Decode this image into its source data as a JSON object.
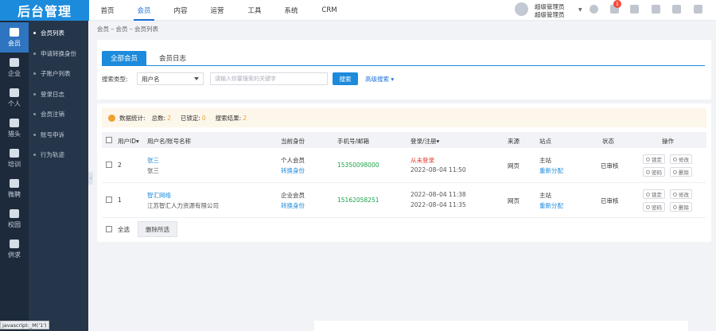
{
  "logo": {
    "text": "后台管理"
  },
  "rail": [
    {
      "label": "会员",
      "active": true
    },
    {
      "label": "企业"
    },
    {
      "label": "个人"
    },
    {
      "label": "猎头"
    },
    {
      "label": "培训"
    },
    {
      "label": "微聘"
    },
    {
      "label": "校园"
    },
    {
      "label": "供求"
    }
  ],
  "subnav": [
    {
      "label": "会员列表",
      "active": true
    },
    {
      "label": "申请转换身份"
    },
    {
      "label": "子账户列表"
    },
    {
      "label": "登录日志"
    },
    {
      "label": "会员注销"
    },
    {
      "label": "账号申诉"
    },
    {
      "label": "行为轨迹"
    }
  ],
  "topnav": [
    {
      "label": "首页"
    },
    {
      "label": "会员",
      "active": true
    },
    {
      "label": "内容"
    },
    {
      "label": "运营"
    },
    {
      "label": "工具"
    },
    {
      "label": "系统"
    },
    {
      "label": "CRM"
    }
  ],
  "user": {
    "line1": "超级管理员",
    "line2": "超级管理员"
  },
  "notification_count": "1",
  "breadcrumb": "会员 – 会员 – 会员列表",
  "tabs": [
    {
      "label": "全部会员",
      "active": true
    },
    {
      "label": "会员日志"
    }
  ],
  "search": {
    "label": "搜索类型:",
    "type_value": "用户名",
    "placeholder": "请输入你要搜索的关键字",
    "button": "搜索",
    "advanced": "高级搜索 ▾"
  },
  "stats": {
    "label": "数据统计:",
    "total_label": "总数:",
    "total": "2",
    "locked_label": "已锁定:",
    "locked": "0",
    "result_label": "搜索结果:",
    "result": "2"
  },
  "table": {
    "headers": {
      "uid": "用户ID▾",
      "name": "用户名/账号名称",
      "identity": "当前身份",
      "phone": "手机号/邮箱",
      "login": "登录/注册▾",
      "source": "来源",
      "site": "站点",
      "status": "状态",
      "ops": "操作"
    },
    "rows": [
      {
        "id": "2",
        "username": "张三",
        "account": "张三",
        "identity": "个人会员",
        "switch": "转换身份",
        "phone": "15350098000",
        "login": "从未登录",
        "register": "2022–08–04 11:50",
        "source": "网页",
        "site": "主站",
        "reassign": "重新分配",
        "status": "已审核"
      },
      {
        "id": "1",
        "username": "智汇网络",
        "account": "江苏智汇人力资源有限公司",
        "identity": "企业会员",
        "switch": "转换身份",
        "phone": "15162058251",
        "login": "2022–08–04 11:38",
        "register": "2022–08–04 11:35",
        "source": "网页",
        "site": "主站",
        "reassign": "重新分配",
        "status": "已审核"
      }
    ],
    "ops": {
      "lock": "锁定",
      "edit": "修改",
      "password": "密码",
      "delete": "删除"
    }
  },
  "footer": {
    "select_all": "全选",
    "batch_delete": "删除所选"
  },
  "status_bar": "javascript:_M('1')",
  "colors": {
    "primary": "#1d8bdc",
    "sidebar": "#1c2a3b",
    "green": "#1aa34a",
    "red": "#e23a2e",
    "orange": "#f0a030"
  }
}
